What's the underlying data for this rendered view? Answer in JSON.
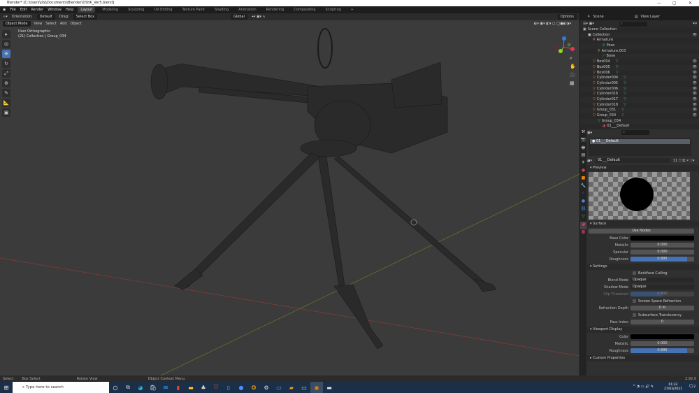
{
  "window": {
    "title": "Blender* [C:\\Users\\jlbj\\Documents\\Blender\\DShK_Ver5.blend]",
    "minimize": "—",
    "maximize": "▢",
    "close": "✕"
  },
  "menu": [
    "File",
    "Edit",
    "Render",
    "Window",
    "Help"
  ],
  "workspaces": [
    "Layout",
    "Modeling",
    "Sculpting",
    "UV Editing",
    "Texture Paint",
    "Shading",
    "Animation",
    "Rendering",
    "Compositing",
    "Scripting",
    "+"
  ],
  "tool_header": {
    "orientation_label": "Orientation:",
    "orientation_value": "Default",
    "drag_label": "Drag:",
    "drag_value": "Select Box",
    "transform": "Global",
    "options": "Options"
  },
  "viewport_header": {
    "mode": "Object Mode",
    "menus": [
      "View",
      "Select",
      "Add",
      "Object"
    ]
  },
  "viewport": {
    "view_name": "User Orthographic",
    "collection_info": "(21) Collection | Group_034"
  },
  "scene": {
    "scene": "Scene",
    "view_layer": "View Layer"
  },
  "outliner": [
    {
      "label": "Scene Collection",
      "indent": 0,
      "icon": "scene"
    },
    {
      "label": "Collection",
      "indent": 1,
      "icon": "collection",
      "eye": true
    },
    {
      "label": "Armature",
      "indent": 2,
      "icon": "armature"
    },
    {
      "label": "Pose",
      "indent": 4,
      "icon": "pose"
    },
    {
      "label": "Armature.003",
      "indent": 3,
      "icon": "armature"
    },
    {
      "label": "Bone",
      "indent": 4,
      "icon": "bone"
    },
    {
      "label": "Box004",
      "indent": 2,
      "icon": "mesh",
      "eye": true
    },
    {
      "label": "Box005",
      "indent": 2,
      "icon": "mesh",
      "eye": true
    },
    {
      "label": "Box006",
      "indent": 2,
      "icon": "mesh",
      "eye": true
    },
    {
      "label": "Cylinder004",
      "indent": 2,
      "icon": "mesh",
      "eye": true
    },
    {
      "label": "Cylinder005",
      "indent": 2,
      "icon": "mesh",
      "eye": true
    },
    {
      "label": "Cylinder006",
      "indent": 2,
      "icon": "mesh",
      "eye": true
    },
    {
      "label": "Cylinder016",
      "indent": 2,
      "icon": "mesh",
      "eye": true
    },
    {
      "label": "Cylinder017",
      "indent": 2,
      "icon": "mesh",
      "eye": true
    },
    {
      "label": "Cylinder018",
      "indent": 2,
      "icon": "mesh",
      "eye": true
    },
    {
      "label": "Group_031",
      "indent": 2,
      "icon": "mesh",
      "eye": true
    },
    {
      "label": "Group_034",
      "indent": 2,
      "icon": "mesh",
      "eye": true
    },
    {
      "label": "Group_034",
      "indent": 3,
      "icon": "meshdata"
    },
    {
      "label": "01___Default",
      "indent": 4,
      "icon": "material"
    }
  ],
  "material": {
    "slot": "01___Default",
    "name": "01___Default",
    "users": "11",
    "preview": "Preview",
    "surface": "Surface",
    "use_nodes": "Use Nodes",
    "surface_props": [
      {
        "label": "Base Color",
        "value": "",
        "type": "color"
      },
      {
        "label": "Metallic",
        "value": "0.000"
      },
      {
        "label": "Specular",
        "value": "0.000"
      },
      {
        "label": "Roughness",
        "value": "0.895",
        "fill": 0.895
      }
    ],
    "settings": "Settings",
    "backface": "Backface Culling",
    "blend_mode_label": "Blend Mode",
    "blend_mode": "Opaque",
    "shadow_mode_label": "Shadow Mode",
    "shadow_mode": "Opaque",
    "clip_label": "Clip Threshold",
    "clip_value": "0.500",
    "ssr": "Screen Space Refraction",
    "refraction_label": "Refraction Depth",
    "refraction_value": "0 m",
    "sst": "Subsurface Translucency",
    "pass_label": "Pass Index",
    "pass_value": "0",
    "viewport_display": "Viewport Display",
    "vd_props": [
      {
        "label": "Color",
        "value": "",
        "type": "color"
      },
      {
        "label": "Metallic",
        "value": "0.000"
      },
      {
        "label": "Roughness",
        "value": "0.895",
        "fill": 0.895
      }
    ],
    "custom": "Custom Properties"
  },
  "statusbar": {
    "select": "Select",
    "box_select": "Box Select",
    "rotate": "Rotate View",
    "context": "Object Context Menu",
    "version": "2.92.0"
  },
  "taskbar": {
    "search_placeholder": "Type here to search",
    "time": "01:32",
    "date": "27/03/2021",
    "notifications": "2"
  }
}
